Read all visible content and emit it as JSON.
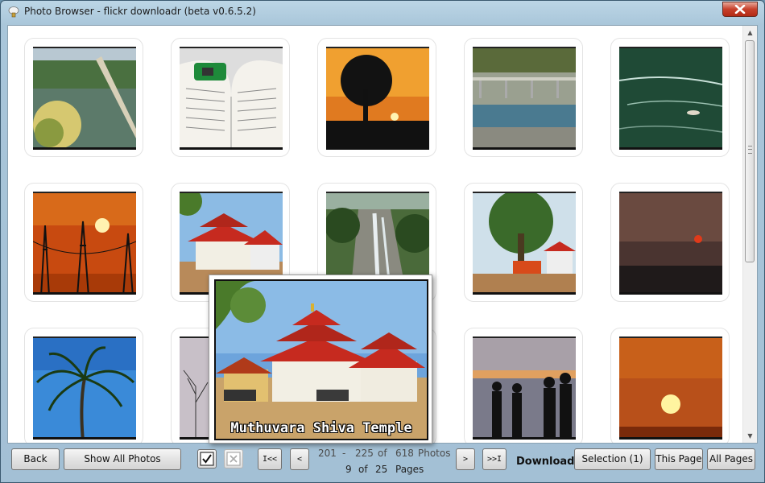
{
  "window": {
    "title": "Photo Browser - flickr downloadr (beta v0.6.5.2)"
  },
  "photos": [
    {
      "name": "dam-bridge-lake",
      "kind": "dam"
    },
    {
      "name": "book-sharpener",
      "kind": "book"
    },
    {
      "name": "tree-sunset",
      "kind": "treesunset"
    },
    {
      "name": "bridge-river",
      "kind": "bridge"
    },
    {
      "name": "river-boat",
      "kind": "river"
    },
    {
      "name": "power-lines-sunset",
      "kind": "towers"
    },
    {
      "name": "kerala-temple",
      "kind": "temple"
    },
    {
      "name": "waterfall-rocks",
      "kind": "waterfall"
    },
    {
      "name": "tree-temple-bus",
      "kind": "treebus"
    },
    {
      "name": "hazy-sunset",
      "kind": "hazysun"
    },
    {
      "name": "coconut-palm",
      "kind": "palm"
    },
    {
      "name": "bare-tree",
      "kind": "bare"
    },
    {
      "name": "hidden",
      "kind": "none"
    },
    {
      "name": "people-silhouettes",
      "kind": "people"
    },
    {
      "name": "red-sun",
      "kind": "redsun"
    }
  ],
  "popup": {
    "caption": "Muthuvara Shiva Temple"
  },
  "toolbar": {
    "back_label": "Back",
    "show_all_label": "Show All Photos",
    "first_label": "I<<",
    "prev_label": "<",
    "next_label": ">",
    "last_label": ">>I",
    "download_label": "Download",
    "selection_label": "Selection (1)",
    "this_page_label": "This Page",
    "all_pages_label": "All Pages"
  },
  "paging": {
    "from": "201",
    "dash": "-",
    "to": "225",
    "of1": "of",
    "total": "618",
    "photos_label": "Photos",
    "page": "9",
    "of2": "of",
    "pages": "25",
    "pages_label": "Pages"
  }
}
